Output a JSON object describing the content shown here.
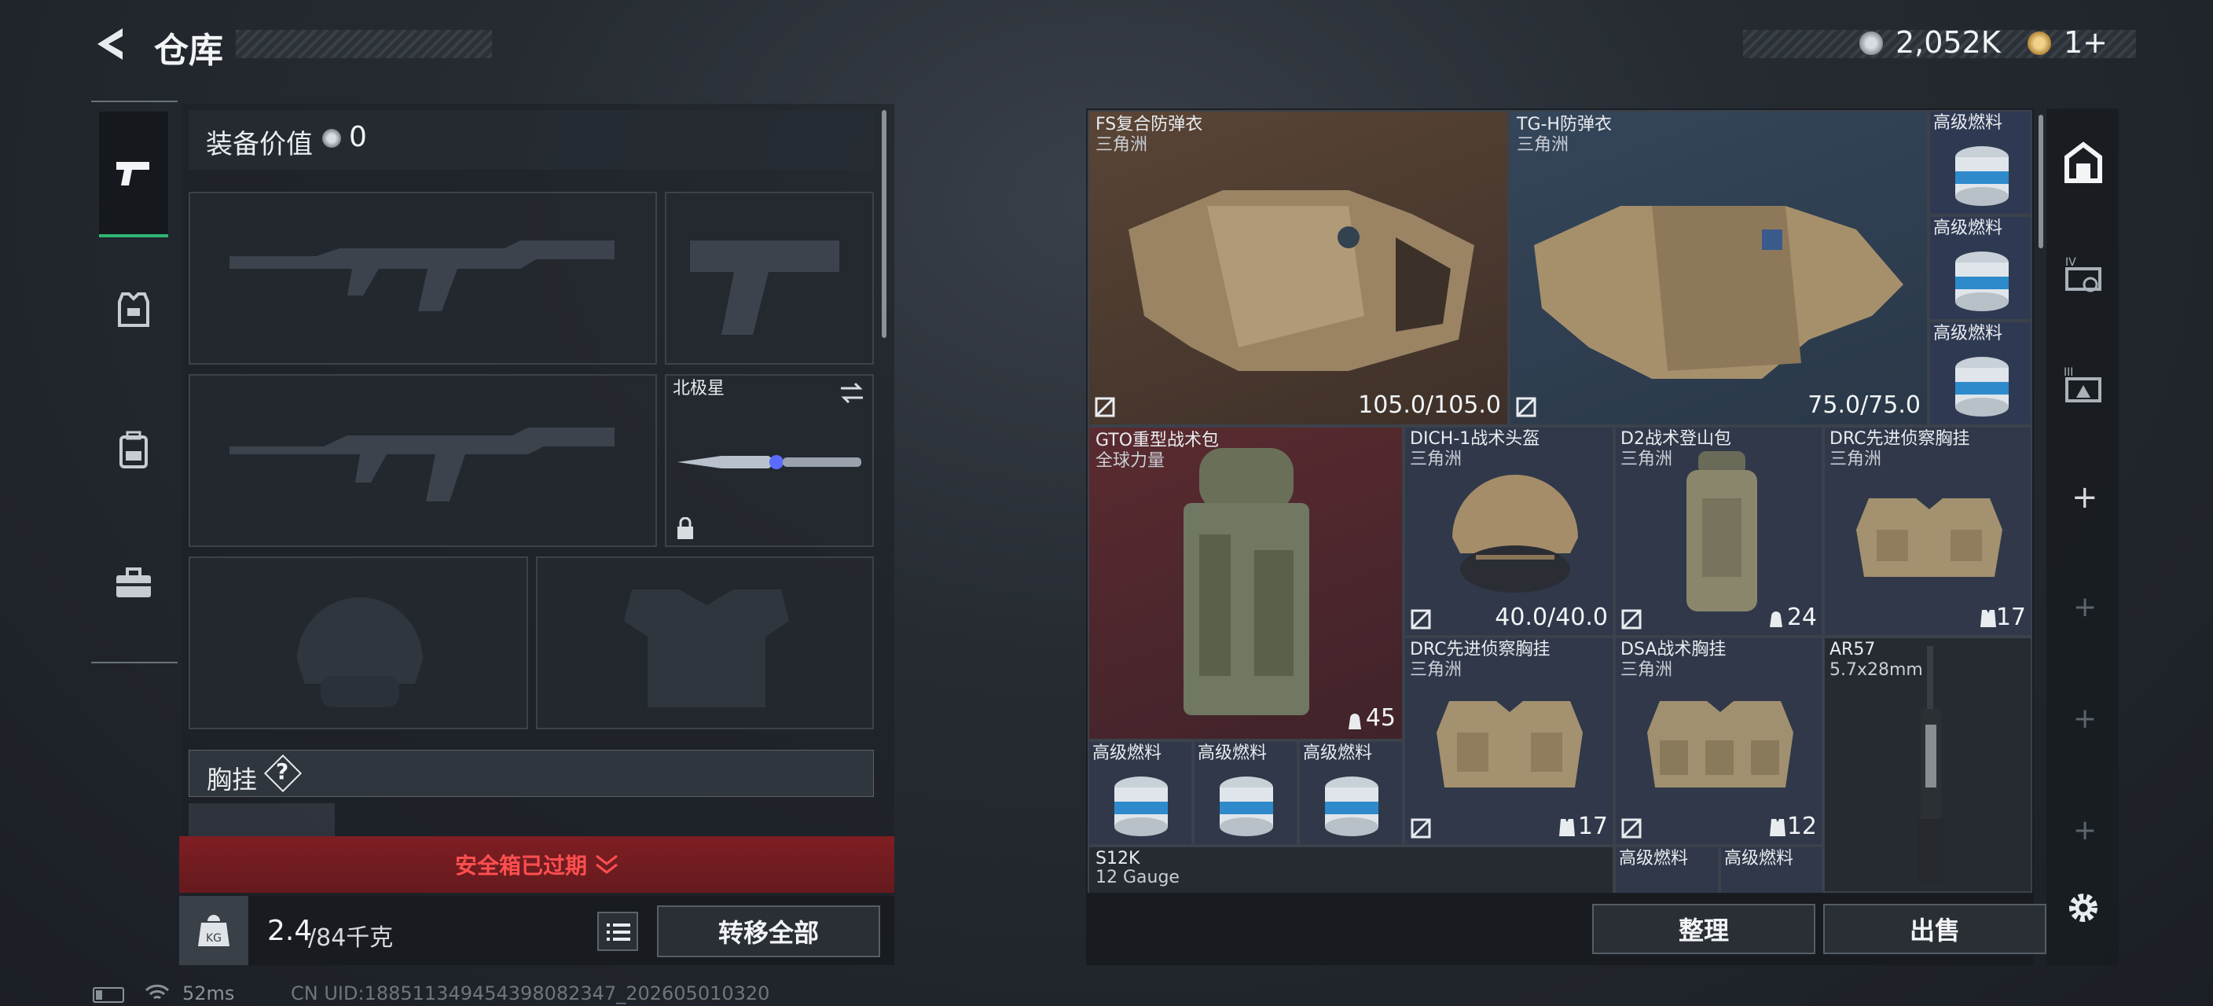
{
  "header": {
    "title": "仓库",
    "currency_value": "2,052K",
    "token_value": "1+"
  },
  "left": {
    "equip_value_label": "装备价值",
    "equip_value": "0",
    "knife_name": "北极星",
    "chest_rig_label": "胸挂",
    "help_icon": "?",
    "secure_case_status": "安全箱已过期",
    "weight_current": "2.4",
    "weight_max": "/84千克",
    "transfer_all": "转移全部"
  },
  "items": {
    "fs_armor": {
      "name": "FS复合防弹衣",
      "source": "三角洲",
      "durability": "105.0/105.0"
    },
    "tgh_armor": {
      "name": "TG-H防弹衣",
      "source": "三角洲",
      "durability": "75.0/75.0"
    },
    "fuel": {
      "name": "高级燃料"
    },
    "gto_bag": {
      "name": "GTO重型战术包",
      "source": "全球力量",
      "capacity": "45"
    },
    "dich_helmet": {
      "name": "DICH-1战术头盔",
      "source": "三角洲",
      "durability": "40.0/40.0"
    },
    "d2_bag": {
      "name": "D2战术登山包",
      "source": "三角洲",
      "capacity": "24"
    },
    "drc_rig_1": {
      "name": "DRC先进侦察胸挂",
      "source": "三角洲",
      "capacity": "17"
    },
    "drc_rig_2": {
      "name": "DRC先进侦察胸挂",
      "source": "三角洲",
      "capacity": "17"
    },
    "dsa_rig": {
      "name": "DSA战术胸挂",
      "source": "三角洲",
      "capacity": "12"
    },
    "ar57": {
      "name": "AR57",
      "caliber": "5.7x28mm"
    },
    "s12k": {
      "name": "S12K",
      "caliber": "12 Gauge"
    }
  },
  "bottom": {
    "sort_button": "整理",
    "sell_button": "出售"
  },
  "status": {
    "ping": "52ms",
    "uid": "CN UID:1885113494543980823​47_202605010320"
  },
  "colors": {
    "accent_green": "#2fb573",
    "red_banner": "#7a1d22",
    "red_text": "#ff4b4b"
  }
}
